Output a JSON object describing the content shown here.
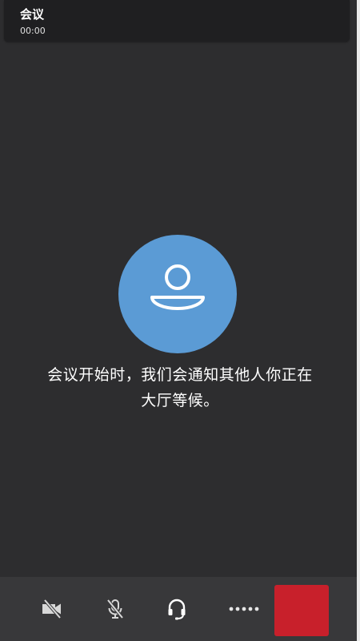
{
  "header": {
    "title": "会议",
    "timer": "00:00"
  },
  "main": {
    "avatar_icon": "person-icon",
    "lobby_message_line1": "会议开始时，我们会通知其他人你正在",
    "lobby_message_line2": "大厅等候。"
  },
  "toolbar": {
    "camera_icon": "camera-off-icon",
    "mic_icon": "mic-off-icon",
    "audio_icon": "headset-icon",
    "more_icon": "more-options-icon",
    "hangup_icon": "hang-up"
  },
  "colors": {
    "background": "#2d2d2f",
    "header": "#1f1f21",
    "avatar": "#5b9bd5",
    "toolbar": "#38383a",
    "hangup": "#c8202b"
  }
}
